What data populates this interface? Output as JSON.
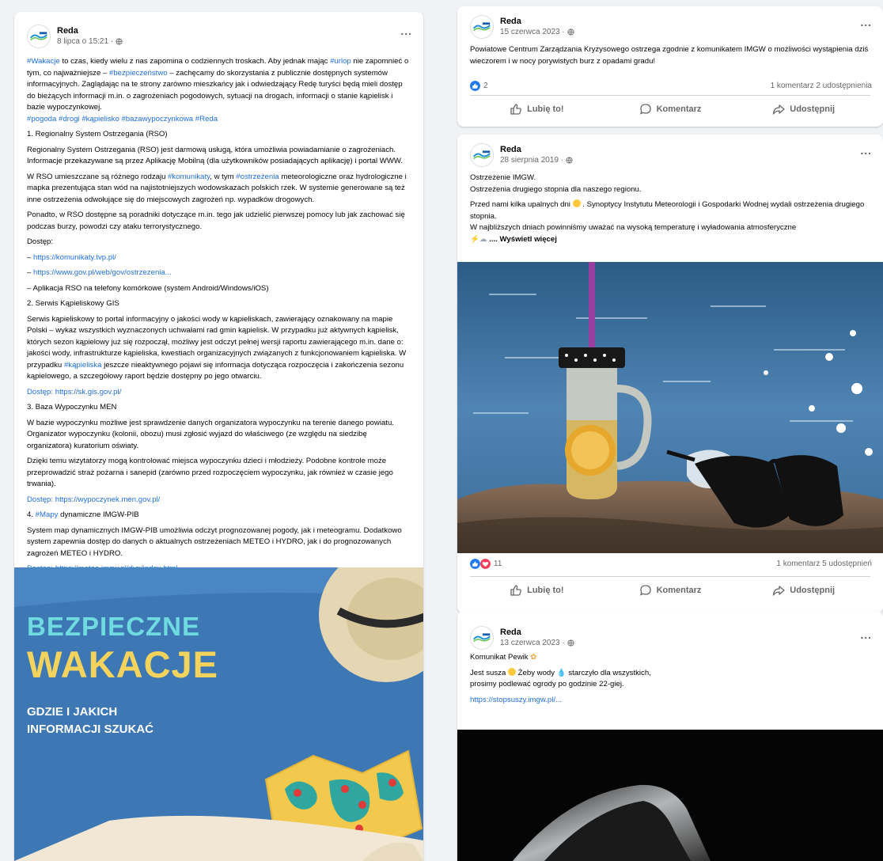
{
  "colors": {
    "link": "#216fdb",
    "like_blue": "#2078f4",
    "love_red": "#f33e58",
    "banner_bg": "#3d78b4",
    "banner_cyan": "#6fdadf",
    "banner_yellow": "#f4d35c"
  },
  "icons": {
    "more": "ellipsis-icon",
    "privacy": "globe-icon",
    "like": "thumbs-up-icon",
    "comment": "speech-bubble-icon",
    "share": "share-arrow-icon"
  },
  "left_post": {
    "author": "Reda",
    "date": "8 lipca o 15:21 ·",
    "more": "...",
    "intro": {
      "hashtag_wakacje": "#Wakacje",
      "t1": " to czas, kiedy wielu z nas zapomina o codziennych troskach. Aby jednak mając ",
      "hashtag_urlop": "#urlop",
      "t2": " nie zapomnieć o tym, co najważniejsze – ",
      "hashtag_bezp": "#bezpieczeństwo",
      "t3": " – zachęcamy do skorzystania z publicznie dostępnych systemów informacyjnych. Zaglądając na te strony zarówno mieszkańcy jak i odwiedzający Redę turyści będą mieli dostęp do bieżących informacji m.in. o zagrożeniach pogodowych, sytuacji na drogach, informacji o stanie kąpielisk i bazie wypoczynkowej.",
      "tags": "#pogoda #drogi #kąpielisko #bazawypoczynkowa #Reda"
    },
    "s1_title": "1. Regionalny System Ostrzegania (RSO)",
    "s1_p1": "Regionalny System Ostrzegania (RSO) jest darmową usługą, która umożliwia powiadamianie o zagrożeniach. Informacje przekazywane są przez Aplikację Mobilną (dla użytkowników posiadających aplikację) i portal WWW.",
    "s1_p2": {
      "a": "W RSO umieszczane są różnego rodzaju ",
      "tag1": "#komunikaty",
      "b": ", w tym ",
      "tag2": "#ostrzeżenia",
      "c": " meteorologiczne oraz hydrologiczne i mapka prezentująca stan wód na najistotniejszych wodowskazach polskich rzek. W systemie generowane są też inne ostrzeżenia odwołujące się do miejscowych zagrożeń np. wypadków drogowych."
    },
    "s1_p3": "Ponadto, w RSO dostępne są poradniki dotyczące m.in. tego jak udzielić pierwszej pomocy lub jak zachować się podczas burzy, powodzi czy ataku terrorystycznego.",
    "access_label": "Dostęp:",
    "dash": "– ",
    "link1": "https://komunikaty.tvp.pl/",
    "link2": "https://www.gov.pl/web/gov/ostrzezenia...",
    "app_line": "– Aplikacja RSO na telefony komórkowe (system Android/Windows/iOS)",
    "s2_title": "2. Serwis Kąpieliskowy GIS",
    "s2_p1": {
      "a": "Serwis kąpieliskowy to portal informacyjny o jakości wody w kąpieliskach, zawierający oznakowany na mapie Polski – wykaz wszystkich wyznaczonych uchwałami rad gmin kąpielisk. W przypadku już aktywnych kąpielisk, których sezon kąpielowy już się rozpoczął, możliwy jest odczyt pełnej wersji raportu zawierającego m.in. dane o: jakości wody, infrastrukturze kąpieliska, kwestiach organizacyjnych związanych z funkcjonowaniem kąpieliska. W przypadku ",
      "tag": "#kąpieliska",
      "b": " jeszcze nieaktywnego pojawi się informacja dotycząca rozpoczęcia i zakończenia sezonu kąpielowego, a szczegółowy raport będzie dostępny po jego otwarciu."
    },
    "s2_access": "Dostęp: https://sk.gis.gov.pl/",
    "s3_title": "3. Baza Wypoczynku MEN",
    "s3_p1": "W bazie wypoczynku możliwe jest sprawdzenie danych organizatora wypoczynku na terenie danego powiatu. Organizator wypoczynku (kolonii, obozu) musi zgłosić wyjazd do właściwego (ze względu na siedzibę organizatora) kuratorium oświaty.",
    "s3_p2": "Dzięki temu wizytatorzy mogą kontrolować miejsca wypoczynku dzieci i młodzieży. Podobne kontrole może przeprowadzić straż pożarna i sanepid (zarówno przed rozpoczęciem wypoczynku, jak również w czasie jego trwania).",
    "s3_access": "Dostęp: https://wypoczynek.men.gov.pl/",
    "s4_title_num": "4. ",
    "s4_title_tag": "#Mapy",
    "s4_title_rest": " dynamiczne IMGW-PIB",
    "s4_p1": "System map dynamicznych IMGW-PIB umożliwia odczyt prognozowanej pogody, jak i meteogramu. Dodatkowo system zapewnia dostęp do danych o aktualnych ostrzeżeniach METEO i HYDRO, jak i do prognozowanych zagrożeń METEO i HYDRO.",
    "s4_access": "Dostęp: https://meteo.imgw.pl/dyn/index.html",
    "banner": {
      "line1": "BEZPIECZNE",
      "line2": "WAKACJE",
      "line3": "GDZIE I JAKICH",
      "line4": "INFORMACJI SZUKAĆ"
    }
  },
  "post1": {
    "author": "Reda",
    "date": "15 czerwca 2023 ·",
    "more": "...",
    "text": "Powiatowe Centrum Zarządzania Kryzysowego ostrzega zgodnie z komunikatem IMGW o możliwości wystąpienia dziś wieczorem i w nocy porywistych burz z opadami gradu!",
    "reaction_count": "2",
    "counts": "1 komentarz  2 udostępnienia",
    "like": "Lubię to!",
    "comment": "Komentarz",
    "share": "Udostępnij"
  },
  "post2": {
    "author": "Reda",
    "date": "28 sierpnia 2019 ·",
    "more": "...",
    "l1": "Ostrzeżenie IMGW.",
    "l2": "Ostrzeżenia drugiego stopnia dla naszego regionu.",
    "p2a": "Przed nami kilka upalnych dni ",
    "p2b": " . Synoptycy Instytutu Meteorologii i Gospodarki Wodnej wydali ostrzeżenia drugiego stopnia.",
    "p3": "W najbliższych dniach powinniśmy uważać na wysoką temperaturę i wyładowania atmosferyczne",
    "more_link": " .... Wyświetl więcej",
    "reaction_count": "11",
    "counts": "1 komentarz  5 udostępnień",
    "like": "Lubię to!",
    "comment": "Komentarz",
    "share": "Udostępnij"
  },
  "post3": {
    "author": "Reda",
    "date": "13 czerwca 2023 ·",
    "more": "...",
    "title": "Komunikat Pewik ",
    "l2a": "Jest susza ",
    "l2b": " Żeby wody ",
    "l2c": " starczyło dla wszystkich,",
    "l3": "prosimy podlewać ogrody po godzinie 22-giej.",
    "link": "https://stopsuszy.imgw.pl/..."
  }
}
